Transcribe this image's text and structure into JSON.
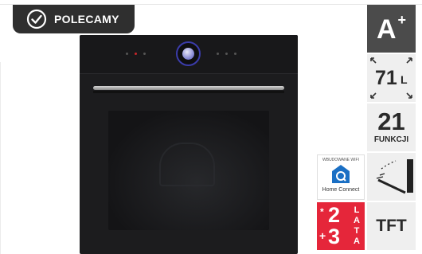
{
  "badge": {
    "label": "POLECAMY",
    "icon": "check-circle-icon"
  },
  "product": {
    "image": "built-in-oven-black"
  },
  "features": {
    "energy_class": {
      "grade": "A",
      "sup": "+"
    },
    "capacity": {
      "value": "71",
      "unit": "L"
    },
    "functions": {
      "count": "21",
      "label": "FUNKCJI"
    },
    "hinge_icon": "door-hinge-icon",
    "display": {
      "label": "TFT"
    }
  },
  "home_connect": {
    "small_text": "WBUDOWANE WIFI",
    "label": "Home Connect"
  },
  "warranty": {
    "star": "*",
    "base": "2",
    "plus": "+",
    "extra": "3",
    "unit": [
      "L",
      "A",
      "T",
      "A"
    ],
    "color": "#e5263a"
  },
  "colors": {
    "badge_bg": "#2f2f2f",
    "tile_bg": "#efefef",
    "tile_dark": "#4b4b4b",
    "accent_blue": "#1a6fc4"
  }
}
